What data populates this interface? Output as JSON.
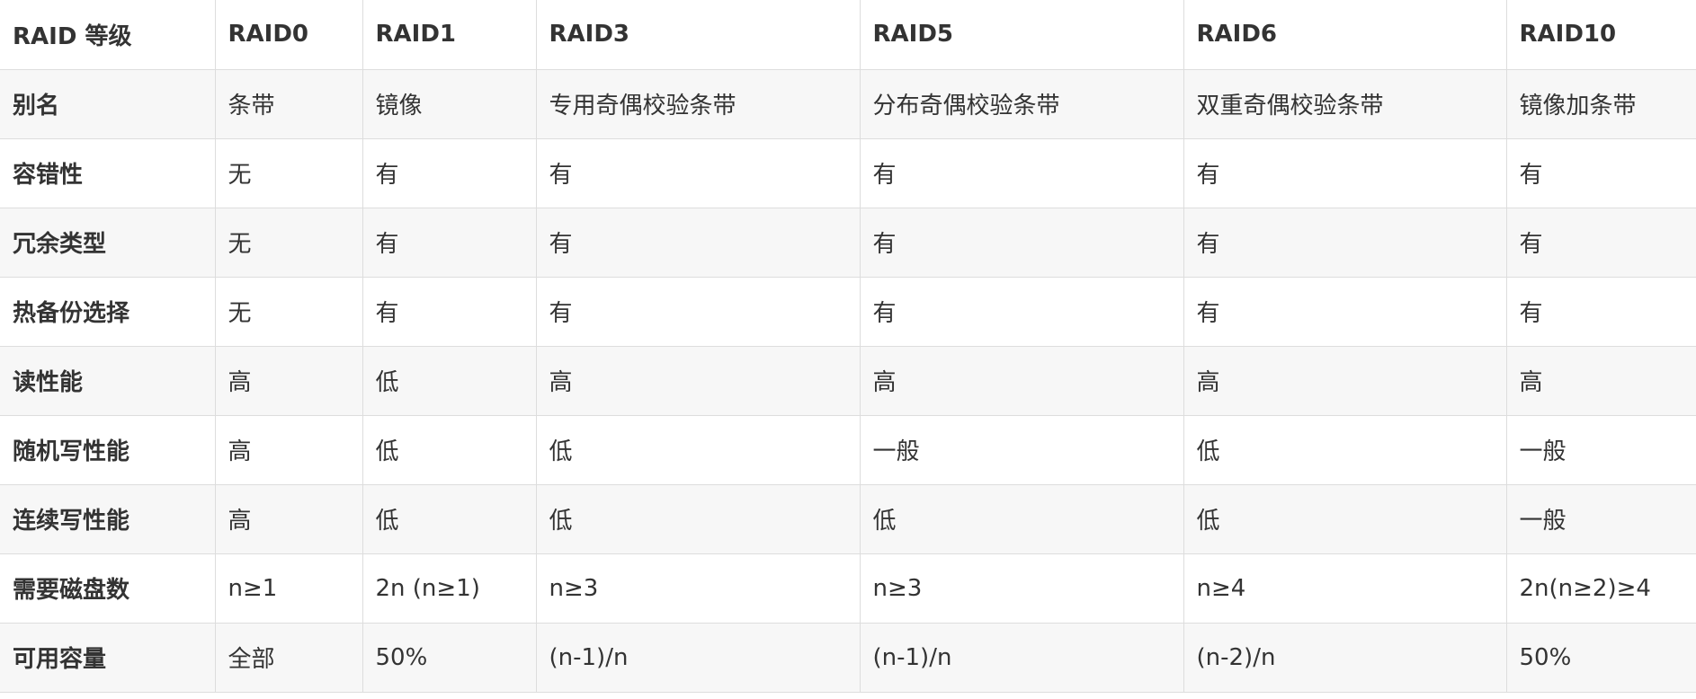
{
  "table": {
    "header": [
      "RAID 等级",
      "RAID0",
      "RAID1",
      "RAID3",
      "RAID5",
      "RAID6",
      "RAID10"
    ],
    "rows": [
      [
        "别名",
        "条带",
        "镜像",
        "专用奇偶校验条带",
        "分布奇偶校验条带",
        "双重奇偶校验条带",
        "镜像加条带"
      ],
      [
        "容错性",
        "无",
        "有",
        "有",
        "有",
        "有",
        "有"
      ],
      [
        "冗余类型",
        "无",
        "有",
        "有",
        "有",
        "有",
        "有"
      ],
      [
        "热备份选择",
        "无",
        "有",
        "有",
        "有",
        "有",
        "有"
      ],
      [
        "读性能",
        "高",
        "低",
        "高",
        "高",
        "高",
        "高"
      ],
      [
        "随机写性能",
        "高",
        "低",
        "低",
        "一般",
        "低",
        "一般"
      ],
      [
        "连续写性能",
        "高",
        "低",
        "低",
        "低",
        "低",
        "一般"
      ],
      [
        "需要磁盘数",
        "n≥1",
        "2n (n≥1)",
        "n≥3",
        "n≥3",
        "n≥4",
        "2n(n≥2)≥4"
      ],
      [
        "可用容量",
        "全部",
        "50%",
        "(n-1)/n",
        "(n-1)/n",
        "(n-2)/n",
        "50%"
      ]
    ]
  },
  "colors": {
    "text": "#333333",
    "border": "#dddddd",
    "stripe": "#f7f7f7",
    "background": "#ffffff"
  }
}
